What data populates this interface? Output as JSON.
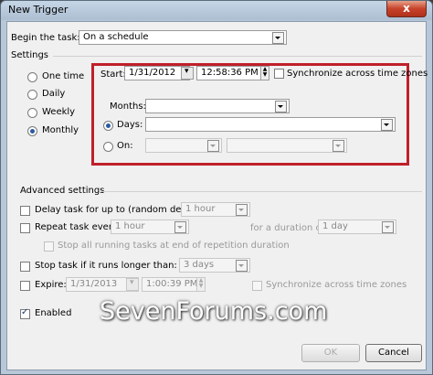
{
  "window": {
    "title": "New Trigger",
    "close_label": "x"
  },
  "begin": {
    "label": "Begin the task:",
    "value": "On a schedule"
  },
  "settings": {
    "label": "Settings",
    "options": [
      {
        "label": "One time",
        "selected": false
      },
      {
        "label": "Daily",
        "selected": false
      },
      {
        "label": "Weekly",
        "selected": false
      },
      {
        "label": "Monthly",
        "selected": true
      }
    ],
    "start_label": "Start:",
    "start_date": "1/31/2012",
    "start_time": "12:58:36 PM",
    "sync_label": "Synchronize across time zones",
    "months_label": "Months:",
    "days_label": "Days:",
    "on_label": "On:",
    "highlight_color": "#c0202a"
  },
  "advanced": {
    "label": "Advanced settings",
    "delay_label": "Delay task for up to (random delay):",
    "delay_value": "1 hour",
    "repeat_label": "Repeat task every:",
    "repeat_value": "1 hour",
    "duration_label": "for a duration of:",
    "duration_value": "1 day",
    "stop_running_label": "Stop all running tasks at end of repetition duration",
    "stop_longer_label": "Stop task if it runs longer than:",
    "stop_longer_value": "3 days",
    "expire_label": "Expire:",
    "expire_date": "1/31/2013",
    "expire_time": "1:00:39 PM",
    "expire_sync_label": "Synchronize across time zones",
    "enabled_label": "Enabled",
    "enabled_checked": true
  },
  "buttons": {
    "ok": "OK",
    "cancel": "Cancel"
  },
  "watermark": "SevenForums.com"
}
